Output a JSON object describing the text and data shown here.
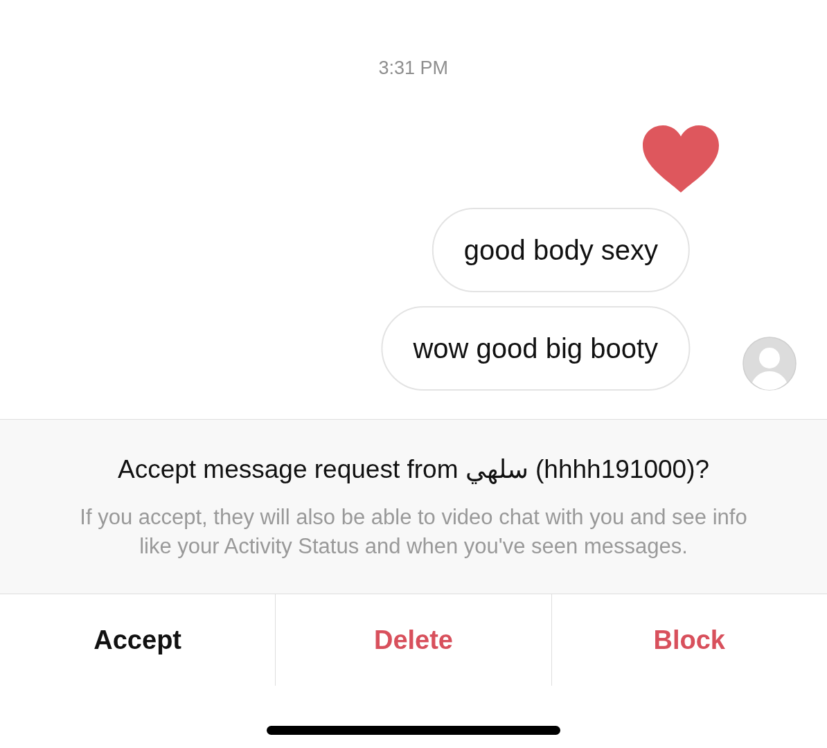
{
  "timestamp": "3:31 PM",
  "messages": [
    {
      "kind": "heart"
    },
    {
      "kind": "text",
      "text": "good body sexy",
      "avatar": false
    },
    {
      "kind": "text",
      "text": "wow good big booty",
      "avatar": true
    }
  ],
  "request": {
    "title": "Accept message request from",
    "sender_name": "سلهي",
    "sender_handle": "(hhhh191000)?",
    "body": "If you accept, they will also be able to video chat with you and see info like your Activity Status and when you've seen messages."
  },
  "actions": [
    {
      "label": "Accept",
      "kind": "default"
    },
    {
      "label": "Delete",
      "kind": "destructive"
    },
    {
      "label": "Block",
      "kind": "destructive"
    }
  ]
}
